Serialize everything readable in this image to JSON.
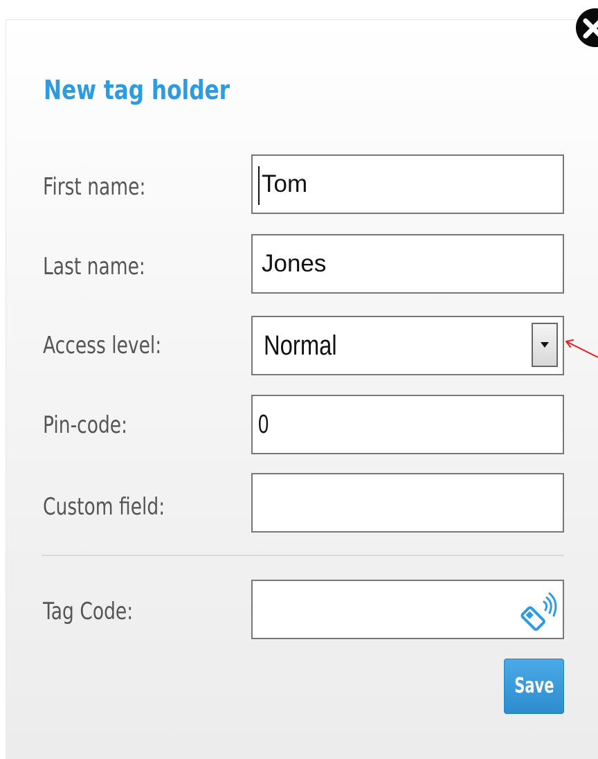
{
  "dialog": {
    "title": "New tag holder",
    "close_icon": "close-x-icon",
    "accent_color": "#2e9be0"
  },
  "fields": {
    "first_name": {
      "label": "First name:",
      "value": "Tom"
    },
    "last_name": {
      "label": "Last name:",
      "value": "Jones"
    },
    "access_level": {
      "label": "Access level:",
      "value": "Normal",
      "icon": "dropdown-arrow-icon"
    },
    "pin_code": {
      "label": "Pin-code:",
      "value": "0"
    },
    "custom_field": {
      "label": "Custom field:",
      "value": ""
    },
    "tag_code": {
      "label": "Tag Code:",
      "value": "",
      "icon": "tag-scan-icon"
    }
  },
  "actions": {
    "save_label": "Save",
    "save_color": "#3399dd"
  },
  "annotation": {
    "arrow_color": "#e0201f",
    "points_to": "access-level-dropdown-button"
  }
}
